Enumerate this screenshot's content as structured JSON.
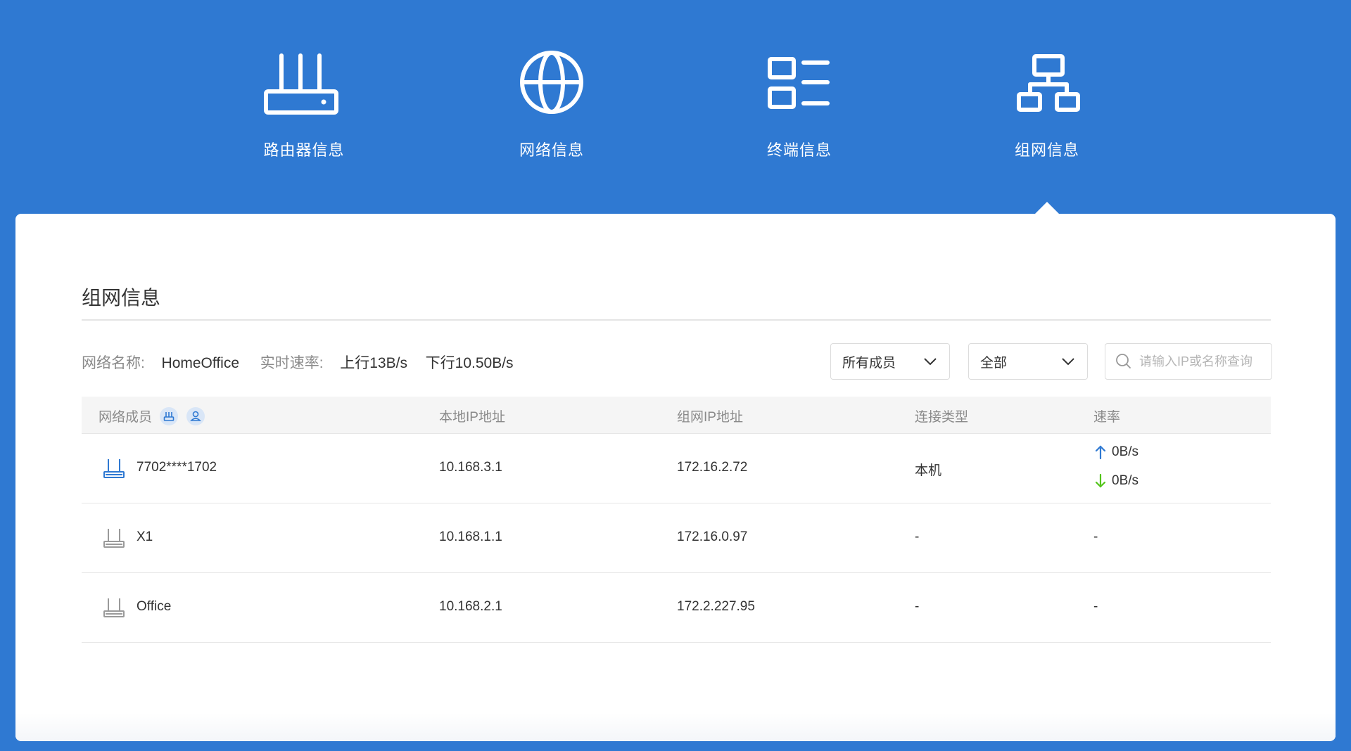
{
  "nav": {
    "items": [
      {
        "label": "路由器信息",
        "icon": "router-icon"
      },
      {
        "label": "网络信息",
        "icon": "globe-icon"
      },
      {
        "label": "终端信息",
        "icon": "device-list-icon"
      },
      {
        "label": "组网信息",
        "icon": "network-topology-icon"
      }
    ],
    "active_index": 3
  },
  "section": {
    "title": "组网信息"
  },
  "info": {
    "network_name_label": "网络名称:",
    "network_name": "HomeOffice",
    "speed_label": "实时速率:",
    "upload": "上行13B/s",
    "download": "下行10.50B/s"
  },
  "filters": {
    "member_select": "所有成员",
    "type_select": "全部",
    "search_placeholder": "请输入IP或名称查询"
  },
  "table": {
    "headers": {
      "member": "网络成员",
      "local_ip": "本地IP地址",
      "mesh_ip": "组网IP地址",
      "conn_type": "连接类型",
      "rate": "速率"
    },
    "rows": [
      {
        "name": "7702****1702",
        "local_ip": "10.168.3.1",
        "mesh_ip": "172.16.2.72",
        "conn_type": "本机",
        "up": "0B/s",
        "down": "0B/s"
      },
      {
        "name": "X1",
        "local_ip": "10.168.1.1",
        "mesh_ip": "172.16.0.97",
        "conn_type": "-",
        "rate": "-"
      },
      {
        "name": "Office",
        "local_ip": "10.168.2.1",
        "mesh_ip": "172.2.227.95",
        "conn_type": "-",
        "rate": "-"
      }
    ]
  },
  "colors": {
    "background": "#2f79d2",
    "card": "#ffffff",
    "upload_arrow": "#2f79d2",
    "download_arrow": "#52c41a"
  }
}
